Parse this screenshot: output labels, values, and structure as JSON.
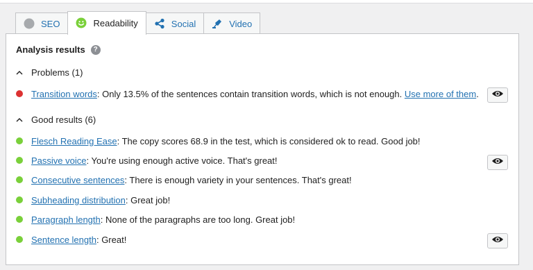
{
  "tabs": [
    {
      "label": "SEO",
      "icon": "gray-circle-icon",
      "active": false
    },
    {
      "label": "Readability",
      "icon": "smiley-icon",
      "active": true
    },
    {
      "label": "Social",
      "icon": "share-icon",
      "active": false
    },
    {
      "label": "Video",
      "icon": "video-icon",
      "active": false
    }
  ],
  "panel": {
    "heading": "Analysis results",
    "help_icon_text": "?",
    "problems": {
      "toggle_label": "Problems (1)",
      "items": [
        {
          "link": "Transition words",
          "text": ": Only 13.5% of the sentences contain transition words, which is not enough. ",
          "link2": "Use more of them",
          "tail": "."
        }
      ]
    },
    "good": {
      "toggle_label": "Good results (6)",
      "items": [
        {
          "link": "Flesch Reading Ease",
          "text": ": The copy scores 68.9 in the test, which is considered ok to read. Good job!"
        },
        {
          "link": "Passive voice",
          "text": ": You're using enough active voice. That's great!"
        },
        {
          "link": "Consecutive sentences",
          "text": ": There is enough variety in your sentences. That's great!"
        },
        {
          "link": "Subheading distribution",
          "text": ": Great job!"
        },
        {
          "link": "Paragraph length",
          "text": ": None of the paragraphs are too long. Great job!"
        },
        {
          "link": "Sentence length",
          "text": ": Great!"
        }
      ]
    }
  },
  "colors": {
    "problem": "#dc3232",
    "good": "#7ad03a",
    "link": "#2271b1",
    "smiley": "#7ad03a"
  }
}
